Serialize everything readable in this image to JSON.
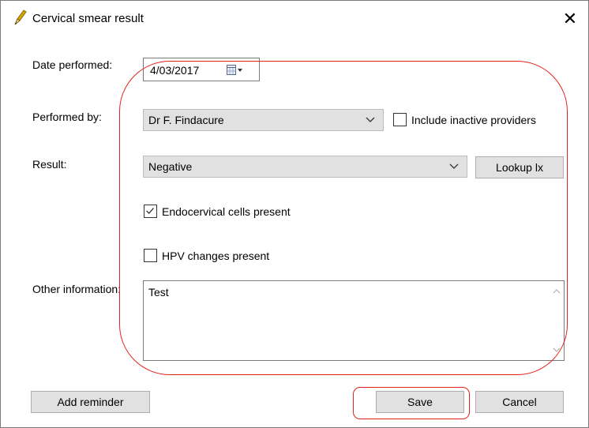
{
  "window": {
    "title": "Cervical smear result",
    "close_glyph": "✕"
  },
  "form": {
    "date_label": "Date performed:",
    "date_value": "4/03/2017",
    "performed_by_label": "Performed by:",
    "performed_by_value": "Dr F. Findacure",
    "include_inactive_label": "Include inactive providers",
    "include_inactive_checked": false,
    "result_label": "Result:",
    "result_value": "Negative",
    "lookup_button": "Lookup lx",
    "endocervical_label": "Endocervical cells present",
    "endocervical_checked": true,
    "hpv_label": "HPV changes present",
    "hpv_checked": false,
    "other_info_label": "Other information:",
    "other_info_value": "Test"
  },
  "footer": {
    "add_reminder": "Add reminder",
    "save": "Save",
    "cancel": "Cancel"
  },
  "colors": {
    "annotation": "#e2231a",
    "button_bg": "#e1e1e1"
  }
}
